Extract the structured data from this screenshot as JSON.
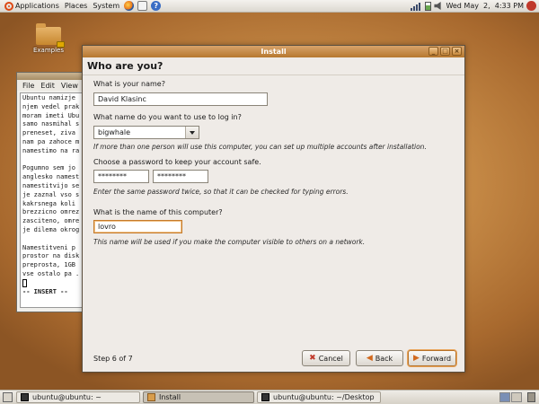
{
  "top_panel": {
    "menus": [
      "Applications",
      "Places",
      "System"
    ],
    "clock": "Wed May  2,  4:33 PM"
  },
  "desktop": {
    "icons": [
      {
        "label": "Examples"
      }
    ]
  },
  "terminal": {
    "menu": [
      "File",
      "Edit",
      "View"
    ],
    "lines": [
      "Ubuntu namizje",
      "njem vedel prak",
      "moram imeti Ubu",
      "samo nasmihal s",
      "preneset, ziva",
      "nam pa zahoce m",
      "namestimo na ra",
      "",
      "Pogumno sem jo",
      "anglesko namest",
      "namestitvijo se",
      "je zaznal vso s",
      "kakrsnega koli",
      "brezzicno omrez",
      "zasciteno, omre",
      "je dilema okrog",
      "",
      "Namestitveni p",
      "prostor na disk",
      "preprosta, 1GB",
      "vse ostalo pa ."
    ],
    "status": "-- INSERT --"
  },
  "installer": {
    "window_title": "Install",
    "header": "Who are you?",
    "name": {
      "label": "What is your name?",
      "value": "David Klasinc"
    },
    "login": {
      "label": "What name do you want to use to log in?",
      "value": "bigwhale",
      "hint": "If more than one person will use this computer, you can set up multiple accounts after installation."
    },
    "password": {
      "label": "Choose a password to keep your account safe.",
      "value": "********",
      "confirm_value": "********",
      "hint": "Enter the same password twice, so that it can be checked for typing errors."
    },
    "computer": {
      "label": "What is the name of this computer?",
      "value": "lovro",
      "hint": "This name will be used if you make the computer visible to others on a network."
    },
    "step": "Step 6 of 7",
    "buttons": {
      "cancel": "Cancel",
      "back": "Back",
      "forward": "Forward"
    }
  },
  "taskbar": {
    "tasks": [
      "ubuntu@ubuntu: ~",
      "Install",
      "ubuntu@ubuntu: ~/Desktop"
    ]
  },
  "colors": {
    "accent": "#c57a2a",
    "titlebar": "#b6782f",
    "desktop": "#c68a46"
  },
  "icons": [
    "ubuntu-logo-icon",
    "firefox-icon",
    "mail-icon",
    "help-icon",
    "signal-icon",
    "battery-icon",
    "volume-icon",
    "power-icon",
    "folder-icon",
    "lock-icon",
    "cancel-icon",
    "back-arrow-icon",
    "forward-arrow-icon",
    "terminal-icon",
    "trash-icon"
  ]
}
